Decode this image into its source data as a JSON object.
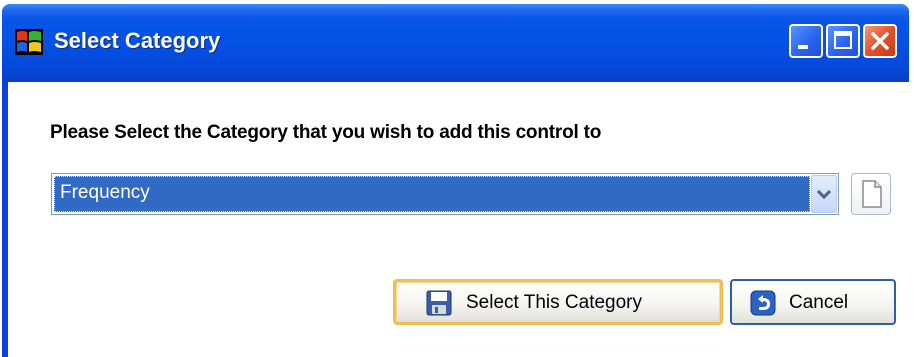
{
  "window": {
    "title": "Select Category",
    "app_icon": "windows-flag-icon",
    "caption_buttons": {
      "minimize_icon": "minimize-icon",
      "maximize_icon": "maximize-icon",
      "close_icon": "close-icon"
    }
  },
  "dialog": {
    "prompt": "Please Select the Category that you wish to add this control to",
    "category_select": {
      "selected_value": "Frequency",
      "arrow_icon": "chevron-down-icon"
    },
    "new_category_button_icon": "new-document-icon",
    "buttons": {
      "select_label": "Select This Category",
      "select_icon": "save-disk-icon",
      "cancel_label": "Cancel",
      "cancel_icon": "back-arrow-icon"
    }
  },
  "colors": {
    "titlebar": "#0551e6",
    "selection": "#316ac5",
    "default_button_border": "#f2bd52",
    "close_button": "#e3512a"
  }
}
